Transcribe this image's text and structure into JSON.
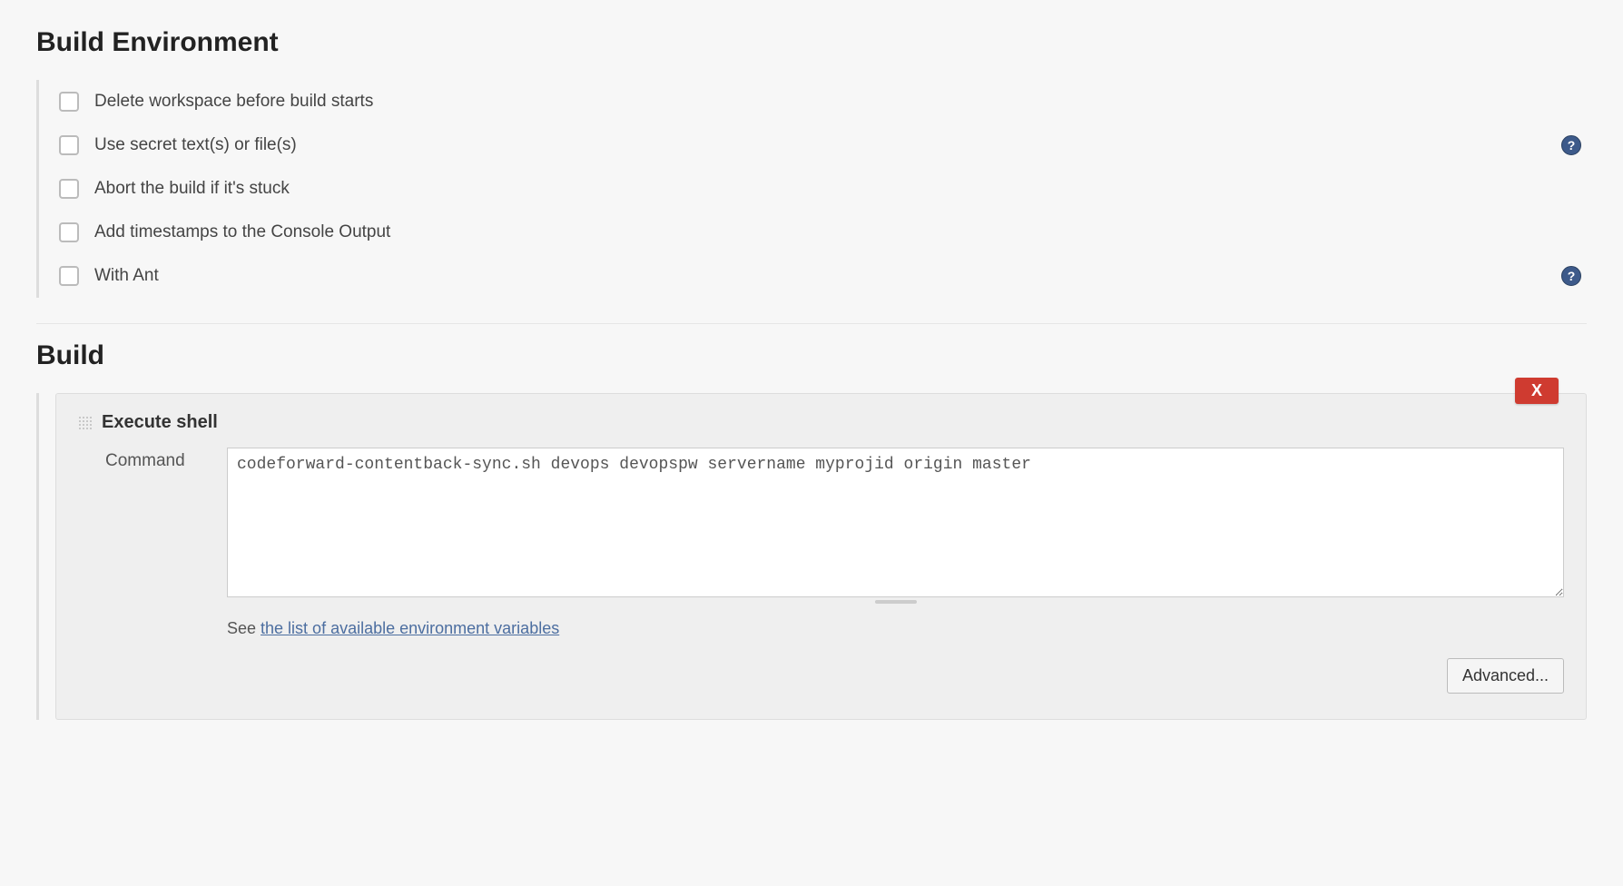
{
  "sections": {
    "build_env_title": "Build Environment",
    "build_title": "Build"
  },
  "env_options": [
    {
      "label": "Delete workspace before build starts",
      "checked": false,
      "help": false
    },
    {
      "label": "Use secret text(s) or file(s)",
      "checked": false,
      "help": true
    },
    {
      "label": "Abort the build if it's stuck",
      "checked": false,
      "help": false
    },
    {
      "label": "Add timestamps to the Console Output",
      "checked": false,
      "help": false
    },
    {
      "label": "With Ant",
      "checked": false,
      "help": true
    }
  ],
  "build_step": {
    "title": "Execute shell",
    "close_label": "X",
    "command_label": "Command",
    "command_value": "codeforward-contentback-sync.sh devops devopspw servername myprojid origin master",
    "hint_prefix": "See ",
    "hint_link_text": "the list of available environment variables",
    "advanced_label": "Advanced..."
  }
}
